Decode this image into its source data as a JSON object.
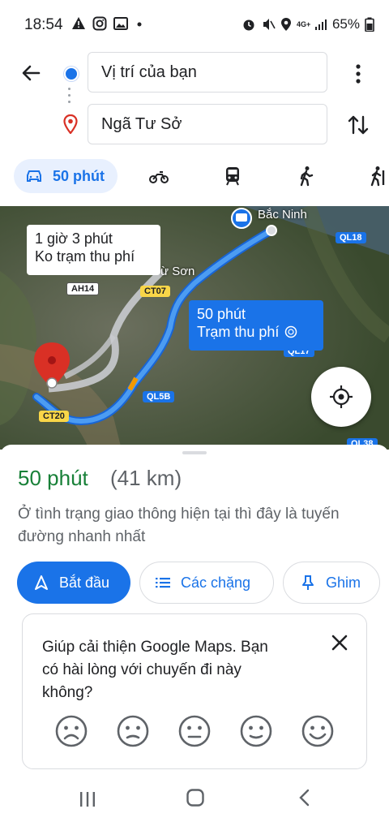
{
  "status_bar": {
    "time": "18:54",
    "battery": "65%",
    "network": "4G+"
  },
  "route_inputs": {
    "origin": "Vị trí của bạn",
    "destination": "Ngã Tư Sở"
  },
  "travel_modes": {
    "active_label": "50 phút",
    "modes": [
      "car-icon",
      "motorbike-icon",
      "train-icon",
      "walk-icon",
      "ride-icon"
    ]
  },
  "map": {
    "city_label": "Bắc Ninh",
    "town_label": "ừ Sơn",
    "alt_route": {
      "line1": "1 giờ 3 phút",
      "line2": "Ko trạm thu phí"
    },
    "main_route": {
      "line1": "50 phút",
      "line2": "Trạm thu phí"
    },
    "roads": [
      "QL18",
      "AH14",
      "CT07",
      "QL17",
      "QL5B",
      "CT20",
      "QL38"
    ]
  },
  "sheet": {
    "duration": "50 phút",
    "distance": "(41 km)",
    "description": "Ở tình trạng giao thông hiện tại thì đây là tuyến đường nhanh nhất",
    "start_label": "Bắt đầu",
    "steps_label": "Các chặng",
    "pin_label": "Ghim"
  },
  "feedback": {
    "text": "Giúp cải thiện Google Maps. Bạn có hài lòng với chuyến đi này không?"
  },
  "colors": {
    "accent": "#1a73e8",
    "green": "#188038",
    "pin": "#d93025"
  }
}
